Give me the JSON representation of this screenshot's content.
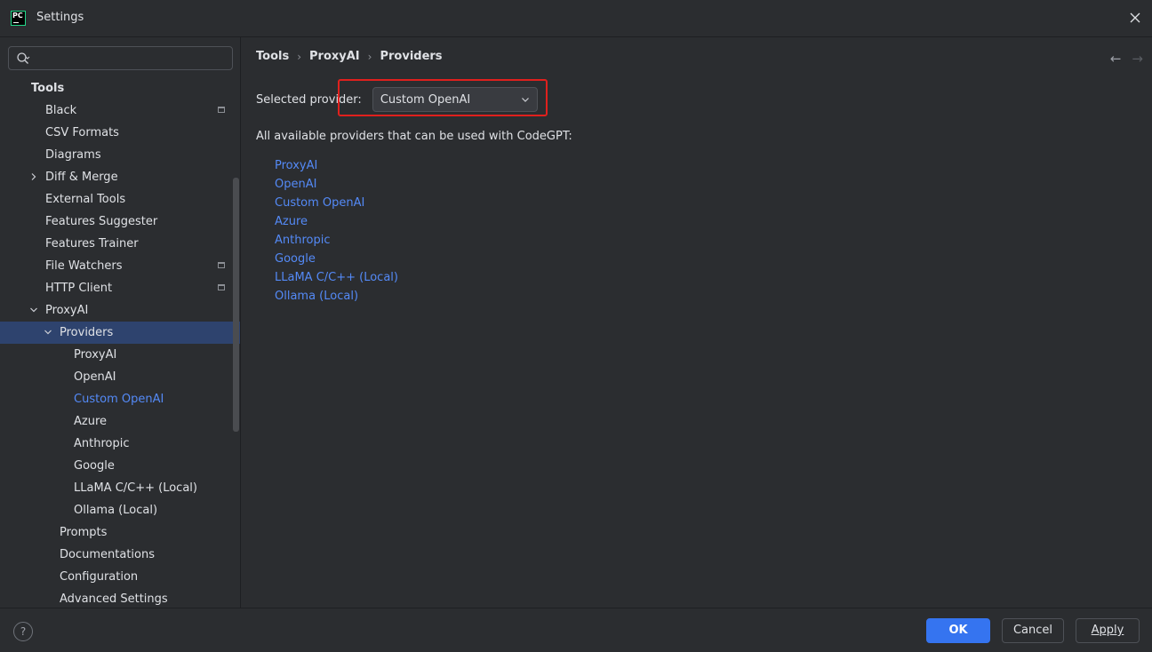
{
  "window": {
    "title": "Settings",
    "logo_text": "PC"
  },
  "search": {
    "value": "",
    "placeholder": ""
  },
  "sidebar": {
    "section": "Tools",
    "items": [
      {
        "label": "Black",
        "level": 1,
        "project_icon": true
      },
      {
        "label": "CSV Formats",
        "level": 1
      },
      {
        "label": "Diagrams",
        "level": 1
      },
      {
        "label": "Diff & Merge",
        "level": 1,
        "chevron": "right"
      },
      {
        "label": "External Tools",
        "level": 1
      },
      {
        "label": "Features Suggester",
        "level": 1
      },
      {
        "label": "Features Trainer",
        "level": 1
      },
      {
        "label": "File Watchers",
        "level": 1,
        "project_icon": true
      },
      {
        "label": "HTTP Client",
        "level": 1,
        "project_icon": true
      },
      {
        "label": "ProxyAI",
        "level": 1,
        "chevron": "down"
      },
      {
        "label": "Providers",
        "level": 2,
        "chevron": "down",
        "selected": true
      },
      {
        "label": "ProxyAI",
        "level": 3
      },
      {
        "label": "OpenAI",
        "level": 3
      },
      {
        "label": "Custom OpenAI",
        "level": 3,
        "active": true
      },
      {
        "label": "Azure",
        "level": 3
      },
      {
        "label": "Anthropic",
        "level": 3
      },
      {
        "label": "Google",
        "level": 3
      },
      {
        "label": "LLaMA C/C++ (Local)",
        "level": 3
      },
      {
        "label": "Ollama (Local)",
        "level": 3
      },
      {
        "label": "Prompts",
        "level": 2
      },
      {
        "label": "Documentations",
        "level": 2
      },
      {
        "label": "Configuration",
        "level": 2
      },
      {
        "label": "Advanced Settings",
        "level": 2
      }
    ]
  },
  "breadcrumb": [
    "Tools",
    "ProxyAI",
    "Providers"
  ],
  "main": {
    "selected_provider_label": "Selected provider:",
    "selected_provider_value": "Custom OpenAI",
    "description": "All available providers that can be used with CodeGPT:",
    "providers": [
      "ProxyAI",
      "OpenAI",
      "Custom OpenAI",
      "Azure",
      "Anthropic",
      "Google",
      "LLaMA C/C++ (Local)",
      "Ollama (Local)"
    ]
  },
  "footer": {
    "help": "?",
    "ok": "OK",
    "cancel": "Cancel",
    "apply": "Apply"
  },
  "colors": {
    "accent": "#3574f0",
    "link": "#548af7",
    "selection": "#2e436e",
    "highlight_box": "#e0201d",
    "background": "#2b2d30"
  }
}
